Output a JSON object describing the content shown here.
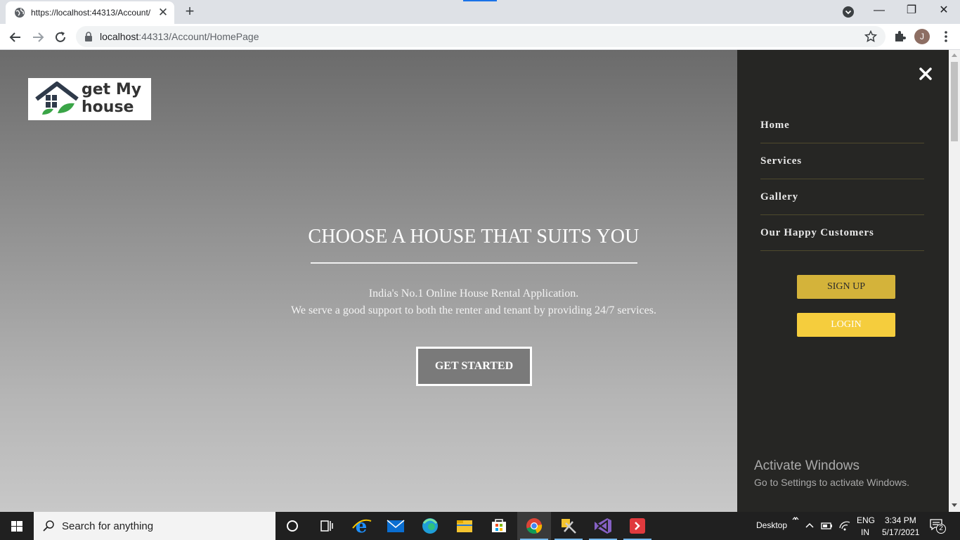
{
  "browser": {
    "tab_title": "https://localhost:44313/Account/",
    "tab_close": "✕",
    "new_tab": "+",
    "url_host": "localhost",
    "url_rest": ":44313/Account/HomePage",
    "profile_initial": "J",
    "window_minimize": "—",
    "window_restore": "❐",
    "window_close": "✕"
  },
  "page": {
    "logo": {
      "line1": "get My",
      "line2": "house"
    },
    "hero": {
      "title": "CHOOSE A HOUSE THAT SUITS YOU",
      "line1": "India's No.1 Online House Rental Application.",
      "line2": "We serve a good support to both the renter and tenant by providing 24/7 services.",
      "cta": "GET STARTED"
    },
    "sidenav": {
      "links": [
        "Home",
        "Services",
        "Gallery",
        "Our Happy Customers"
      ],
      "signup": "SIGN UP",
      "login": "LOGIN"
    },
    "watermark": {
      "title": "Activate Windows",
      "subtitle": "Go to Settings to activate Windows."
    }
  },
  "taskbar": {
    "search_placeholder": "Search for anything",
    "desktop_label": "Desktop",
    "lang_top": "ENG",
    "lang_bottom": "IN",
    "time": "3:34 PM",
    "date": "5/17/2021",
    "notification_count": "2"
  },
  "colors": {
    "signup_bg": "#d4b33a",
    "login_bg": "#f5cd3d",
    "sidenav_bg": "#262624",
    "taskbar_bg": "#202020"
  }
}
